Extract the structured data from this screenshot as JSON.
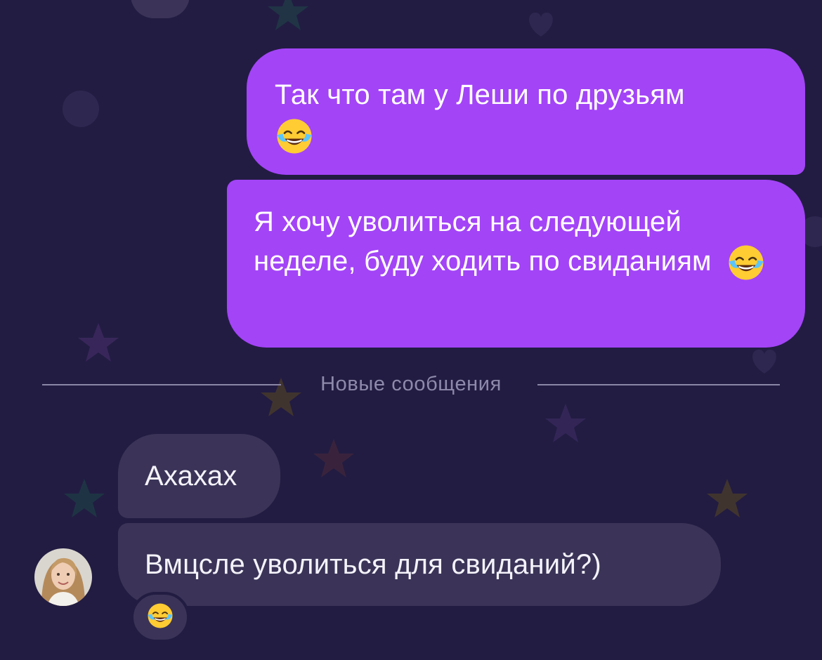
{
  "messages": {
    "outgoing": [
      {
        "text": "Так что там у Леши по друзьям",
        "emoji": "face-with-tears-of-joy"
      },
      {
        "text": "Я хочу уволиться на следующей неделе, буду ходить по свиданиям",
        "emoji": "face-with-tears-of-joy"
      }
    ],
    "divider_label": "Новые сообщения",
    "incoming": [
      {
        "text": "Ахахах"
      },
      {
        "text": "Вмцсле уволиться для свиданий?)"
      }
    ],
    "reaction": "face-with-tears-of-joy"
  },
  "colors": {
    "background": "#221c42",
    "outgoing_bubble": "#a344f7",
    "incoming_bubble": "#3b3458",
    "divider": "#8a86a6"
  }
}
